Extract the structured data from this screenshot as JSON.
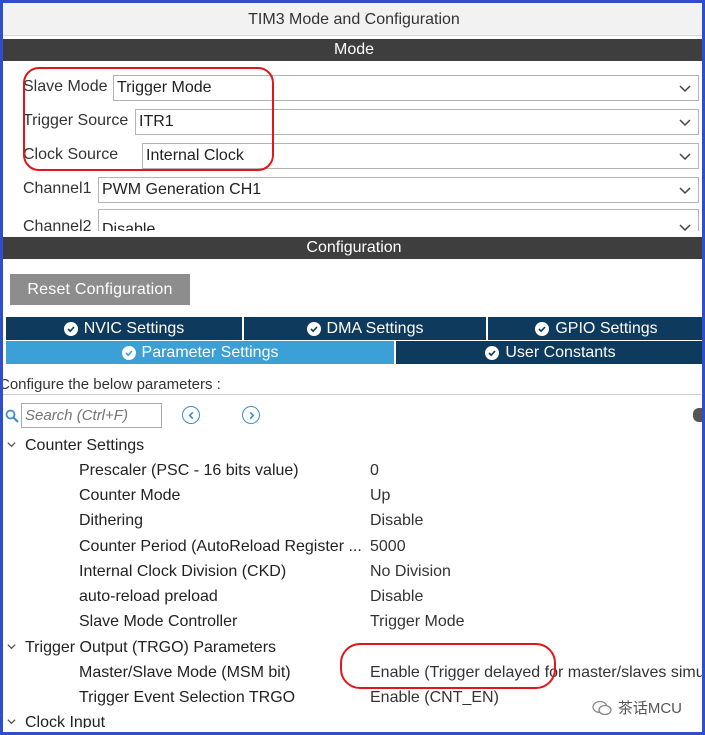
{
  "window": {
    "title": "TIM3 Mode and Configuration"
  },
  "mode_section": {
    "header": "Mode",
    "rows": [
      {
        "label": "Slave Mode",
        "value": "Trigger Mode"
      },
      {
        "label": "Trigger Source",
        "value": "ITR1"
      },
      {
        "label": "Clock Source",
        "value": "Internal Clock"
      },
      {
        "label": "Channel1",
        "value": "PWM Generation CH1"
      },
      {
        "label": "Channel2",
        "value": "Disable"
      }
    ]
  },
  "config_section": {
    "header": "Configuration",
    "reset_label": "Reset Configuration",
    "tabs_row1": [
      {
        "label": "NVIC Settings"
      },
      {
        "label": "DMA Settings"
      },
      {
        "label": "GPIO Settings"
      }
    ],
    "tabs_row2": [
      {
        "label": "Parameter Settings",
        "active": true
      },
      {
        "label": "User Constants"
      }
    ],
    "caption": "Configure the below parameters :",
    "search_placeholder": "Search (Ctrl+F)"
  },
  "groups": [
    {
      "title": "Counter Settings",
      "params": [
        {
          "name": "Prescaler (PSC - 16 bits value)",
          "value": "0"
        },
        {
          "name": "Counter Mode",
          "value": "Up"
        },
        {
          "name": "Dithering",
          "value": "Disable"
        },
        {
          "name": "Counter Period (AutoReload Register ...",
          "value": "5000"
        },
        {
          "name": "Internal Clock Division (CKD)",
          "value": "No Division"
        },
        {
          "name": "auto-reload preload",
          "value": "Disable"
        },
        {
          "name": "Slave Mode Controller",
          "value": "Trigger Mode"
        }
      ]
    },
    {
      "title": "Trigger Output (TRGO) Parameters",
      "params": [
        {
          "name": "Master/Slave Mode (MSM bit)",
          "value": "Enable (Trigger delayed for master/slaves simu"
        },
        {
          "name": "Trigger Event Selection TRGO",
          "value": "Enable (CNT_EN)"
        }
      ]
    },
    {
      "title": "Clock Input",
      "params": []
    }
  ],
  "watermark": {
    "text": "茶话MCU"
  },
  "colors": {
    "frame": "#2f4fc9",
    "annotation": "#e3151a",
    "tab_dark": "#0e3a5d",
    "tab_active": "#3aa0d6"
  }
}
